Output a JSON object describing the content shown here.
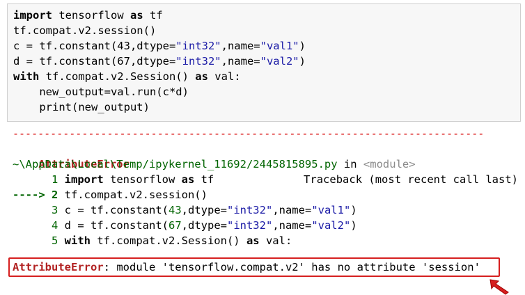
{
  "input_cell": {
    "lines": [
      {
        "p1": "import",
        "p2": " tensorflow ",
        "p3": "as",
        "p4": " tf"
      },
      {
        "text": "tf.compat.v2.session()"
      },
      {
        "a": "c = tf.constant(43,dtype=",
        "s1": "\"int32\"",
        "b": ",name=",
        "s2": "\"val1\"",
        "c": ")"
      },
      {
        "a": "d = tf.constant(67,dtype=",
        "s1": "\"int32\"",
        "b": ",name=",
        "s2": "\"val2\"",
        "c": ")"
      },
      {
        "k1": "with",
        "m": " tf.compat.v2.Session() ",
        "k2": "as",
        "e": " val:"
      },
      {
        "text": "    new_output=val.run(c*d)"
      },
      {
        "text": "    print(new_output)"
      }
    ]
  },
  "output": {
    "separator": "---------------------------------------------------------------------------",
    "error_name": "AttributeError",
    "traceback_label": "Traceback (most recent call last)",
    "file_path": "~\\AppData\\Local\\Temp/ipykernel_11692/2445815895.py",
    "file_in": " in ",
    "module": "<module>",
    "tb_lines": [
      {
        "num": "      1",
        "code_k1": "import",
        "code_a": " tensorflow ",
        "code_k2": "as",
        "code_b": " tf"
      },
      {
        "arrow": "----> 2",
        "code": "tf.compat.v2.session()"
      },
      {
        "num": "      3",
        "a": "c = tf.constant(",
        "n": "43",
        "b": ",dtype=",
        "s1": "\"int32\"",
        "c": ",name=",
        "s2": "\"val1\"",
        "d": ")"
      },
      {
        "num": "      4",
        "a": "d = tf.constant(",
        "n": "67",
        "b": ",dtype=",
        "s1": "\"int32\"",
        "c": ",name=",
        "s2": "\"val2\"",
        "d": ")"
      },
      {
        "num": "      5",
        "k1": "with",
        "m": " tf.compat.v2.Session() ",
        "k2": "as",
        "e": " val:"
      }
    ],
    "final_error_name": "AttributeError",
    "final_message": ": module 'tensorflow.compat.v2' has no attribute 'session'"
  },
  "colors": {
    "highlight": "#d61f1f",
    "error": "#b22222"
  }
}
